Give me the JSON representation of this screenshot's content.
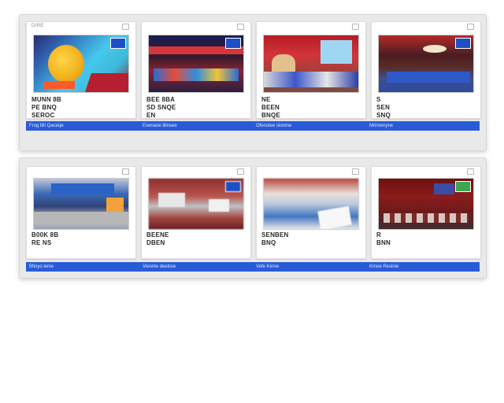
{
  "rows": [
    {
      "cards": [
        {
          "mini": "DIRE",
          "caption": "MUNN 8B\nPE BNQ\nSEROC"
        },
        {
          "mini": "",
          "caption": "BEE 8BA\nSD SNQE\nEN"
        },
        {
          "mini": "",
          "caption": "NE\nBEEN\nBNQE"
        },
        {
          "mini": "",
          "caption": "S\nSEN\nSNQ"
        }
      ],
      "bar_labels": [
        "Frog lBI Qaceqe",
        "Evenaoe lilinsee",
        "Ofenstee slonme",
        "Mrinrenyne"
      ]
    },
    {
      "cards": [
        {
          "mini": "",
          "caption": "B00K 8B\nRE NS"
        },
        {
          "mini": "",
          "caption": "BEENE\nDBEN"
        },
        {
          "mini": "",
          "caption": "SENBEN\nBNQ"
        },
        {
          "mini": "",
          "caption": "R\nBNN"
        }
      ],
      "bar_labels": [
        "Bfioyo lenie",
        "Vieonle deelsse",
        "Vefe Kinne",
        "Kmoe Reslnie"
      ]
    }
  ],
  "colors": {
    "accent_bar": "#2a5bd7",
    "panel_bg": "#e9e9ea"
  }
}
